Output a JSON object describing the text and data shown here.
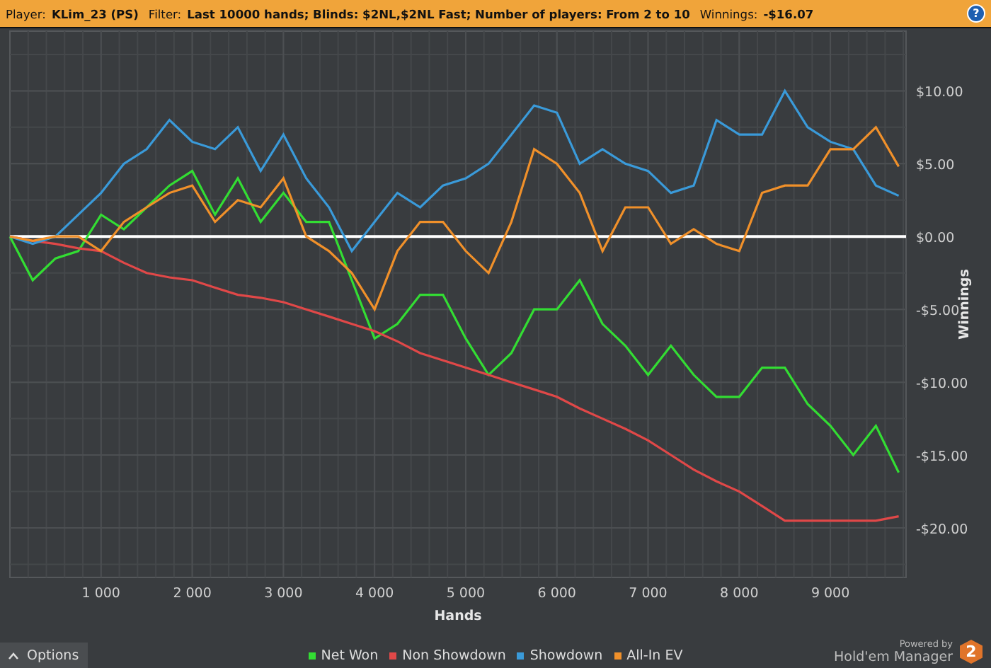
{
  "filter_bar": {
    "fields": [
      {
        "label": "Player:",
        "value": "KLim_23 (PS)"
      },
      {
        "label": "Filter:",
        "value": "Last 10000 hands; Blinds: $2NL,$2NL Fast; Number of players: From 2 to 10"
      },
      {
        "label": "Winnings:",
        "value": "-$16.07"
      }
    ],
    "help_icon": "?"
  },
  "graph": {
    "chart_data": {
      "type": "line",
      "xlabel": "Hands",
      "ylabel": "Winnings",
      "x": [
        0,
        250,
        500,
        750,
        1000,
        1250,
        1500,
        1750,
        2000,
        2250,
        2500,
        2750,
        3000,
        3250,
        3500,
        3750,
        4000,
        4250,
        4500,
        4750,
        5000,
        5250,
        5500,
        5750,
        6000,
        6250,
        6500,
        6750,
        7000,
        7250,
        7500,
        7750,
        8000,
        8250,
        8500,
        8750,
        9000,
        9250,
        9500,
        9750
      ],
      "series": [
        {
          "name": "Net Won",
          "color": "#33dd33",
          "values": [
            0,
            -3,
            -1.5,
            -1,
            1.5,
            0.5,
            2,
            3.5,
            4.5,
            1.5,
            4,
            1,
            3,
            1,
            1,
            -3,
            -7,
            -6,
            -4,
            -4,
            -7,
            -9.5,
            -8,
            -5,
            -5,
            -3,
            -6,
            -7.5,
            -9.5,
            -7.5,
            -9.5,
            -11,
            -11,
            -9,
            -9,
            -11.5,
            -13,
            -15,
            -13,
            -16.2
          ]
        },
        {
          "name": "Non Showdown",
          "color": "#e04848",
          "values": [
            0,
            -0.3,
            -0.5,
            -0.8,
            -1,
            -1.8,
            -2.5,
            -2.8,
            -3,
            -3.5,
            -4,
            -4.2,
            -4.5,
            -5,
            -5.5,
            -6,
            -6.5,
            -7.2,
            -8,
            -8.5,
            -9,
            -9.5,
            -10,
            -10.5,
            -11,
            -11.8,
            -12.5,
            -13.2,
            -14,
            -15,
            -16,
            -16.8,
            -17.5,
            -18.5,
            -19.5,
            -19.5,
            -19.5,
            -19.5,
            -19.5,
            -19.2
          ]
        },
        {
          "name": "Showdown",
          "color": "#3a9ad9",
          "values": [
            0,
            -0.5,
            0,
            1.5,
            3,
            5,
            6,
            8,
            6.5,
            6,
            7.5,
            4.5,
            7,
            4,
            2,
            -1,
            1,
            3,
            2,
            3.5,
            4,
            5,
            7,
            9,
            8.5,
            5,
            6,
            5,
            4.5,
            3,
            3.5,
            8,
            7,
            7,
            10,
            7.5,
            6.5,
            6,
            3.5,
            2.8
          ]
        },
        {
          "name": "All-In EV",
          "color": "#f0902a",
          "values": [
            0,
            -0.3,
            0,
            0,
            -1,
            1,
            2,
            3,
            3.5,
            1,
            2.5,
            2,
            4,
            0,
            -1,
            -2.5,
            -5,
            -1,
            1,
            1,
            -1,
            -2.5,
            1,
            6,
            5,
            3,
            -1,
            2,
            2,
            -0.5,
            0.5,
            -0.5,
            -1,
            3,
            3.5,
            3.5,
            6,
            6,
            7.5,
            4.8
          ]
        }
      ],
      "grid": true,
      "xlim": [
        0,
        9830
      ],
      "ylim": [
        -23.4,
        14.1
      ],
      "xticks": [
        {
          "value": 1000,
          "label": "1 000"
        },
        {
          "value": 2000,
          "label": "2 000"
        },
        {
          "value": 3000,
          "label": "3 000"
        },
        {
          "value": 4000,
          "label": "4 000"
        },
        {
          "value": 5000,
          "label": "5 000"
        },
        {
          "value": 6000,
          "label": "6 000"
        },
        {
          "value": 7000,
          "label": "7 000"
        },
        {
          "value": 8000,
          "label": "8 000"
        },
        {
          "value": 9000,
          "label": "9 000"
        }
      ],
      "yticks": [
        {
          "value": 10,
          "label": "$10.00"
        },
        {
          "value": 5,
          "label": "$5.00"
        },
        {
          "value": 0,
          "label": "$0.00"
        },
        {
          "value": -5,
          "label": "-$5.00"
        },
        {
          "value": -10,
          "label": "-$10.00"
        },
        {
          "value": -15,
          "label": "-$15.00"
        },
        {
          "value": -20,
          "label": "-$20.00"
        }
      ]
    }
  },
  "options_button": "Options",
  "branding": {
    "powered_by": "Powered by",
    "product": "Hold'em Manager",
    "logo_badge": "2"
  }
}
